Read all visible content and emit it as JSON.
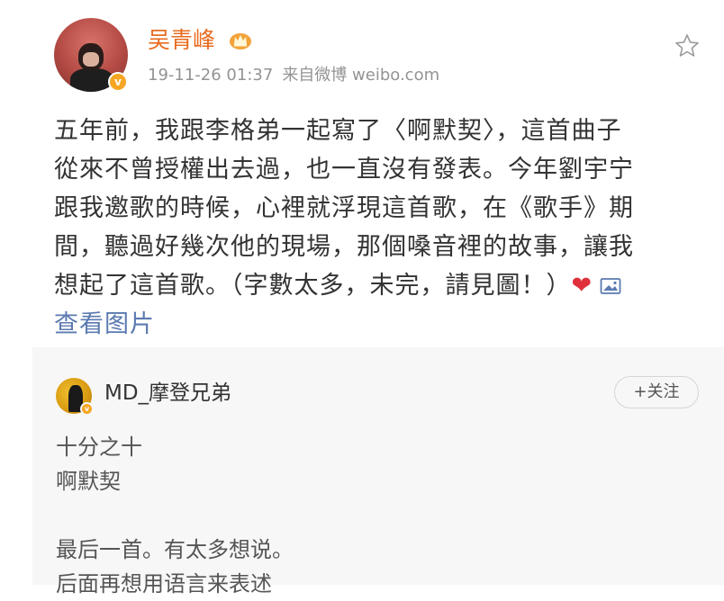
{
  "post": {
    "username": "吴青峰",
    "meta": {
      "timestamp": "19-11-26 01:37",
      "source": "来自微博 weibo.com"
    },
    "content_lines": [
      "五年前，我跟李格弟一起寫了〈啊默契〉，這首曲子",
      "從來不曾授權出去過，也一直沒有發表。今年劉宇宁",
      "跟我邀歌的時候，心裡就浮現這首歌，在《歌手》期",
      "間，聽過好幾次他的現場，那個嗓音裡的故事，讓我",
      "想起了這首歌。（字數太多，未完，請見圖！）"
    ],
    "view_pictures_label": "查看图片",
    "icons": {
      "avatar_badge": "verified-v-icon",
      "crown": "crown-icon",
      "star": "star-icon",
      "heart": "heart-emoji-icon",
      "picture": "picture-icon"
    },
    "colors": {
      "username": "#e86b1f",
      "link": "#5b7ab0",
      "heart": "#e0303c",
      "repost_bg": "#f7f7f7"
    }
  },
  "repost": {
    "username": "MD_摩登兄弟",
    "follow_label": "+关注",
    "text_lines": [
      "十分之十",
      "啊默契",
      "",
      "最后一首。有太多想说。",
      "后面再想用语言来表述"
    ]
  }
}
